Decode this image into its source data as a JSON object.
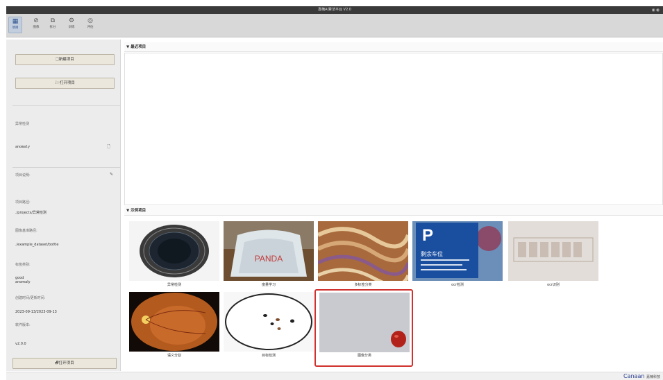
{
  "window": {
    "title": "嘉楠AI算法平台 V2.0",
    "controls": "◉◉"
  },
  "toolbar": {
    "items": [
      {
        "label": "项目",
        "icon": "project-icon",
        "glyph": "▦",
        "active": true
      },
      {
        "label": "图像",
        "icon": "image-icon",
        "glyph": "⊘",
        "active": false
      },
      {
        "label": "拆分",
        "icon": "split-icon",
        "glyph": "⧉",
        "active": false
      },
      {
        "label": "训练",
        "icon": "train-icon",
        "glyph": "⚙",
        "active": false
      },
      {
        "label": "评估",
        "icon": "evaluate-icon",
        "glyph": "◎",
        "active": false
      }
    ]
  },
  "left": {
    "new_project": "🗋新建项目",
    "open_project": "🗁打开项目",
    "task_type": "异常检测",
    "project_name": "anomaly",
    "desc_label": "项目说明:",
    "path_label": "项目路径:",
    "path_value": "./projects/异常检测",
    "dataset_label": "图像基准路径:",
    "dataset_value": "./example_dataset/bottle",
    "labels_label": "标签类别:",
    "labels_value_1": "good",
    "labels_value_2": "anomaly",
    "date_label": "创建时间/更新时间:",
    "date_value": "2023-09-13/2023-09-13",
    "version_label": "软件版本:",
    "version_value": "v2.0.0",
    "open_button": "🗗打开项目"
  },
  "main": {
    "recent_title": "最近项目",
    "examples_title": "示例项目",
    "examples": [
      {
        "label": "异常检测"
      },
      {
        "label": "度量学习"
      },
      {
        "label": "多标签分类"
      },
      {
        "label": "ocr检测"
      },
      {
        "label": "ocr识别"
      },
      {
        "label": "语义分割"
      },
      {
        "label": "目标检测"
      },
      {
        "label": "图像分类"
      }
    ]
  },
  "thumb_text": {
    "panda": "PANDA",
    "parking": "P",
    "parking_sign": "剩余车位"
  },
  "footer": {
    "brand": "Canaan",
    "brand_sub": "嘉楠科技"
  },
  "colors": {
    "selection": "#d0312d",
    "brand": "#2a3f8f"
  }
}
